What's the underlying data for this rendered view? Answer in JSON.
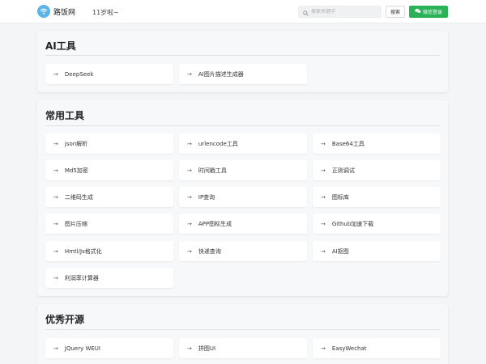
{
  "header": {
    "logo_text": "路饭网",
    "slogan": "11岁啦~",
    "search_placeholder": "搜索关键字",
    "search_button": "搜索",
    "wechat_login": "微信登录",
    "brand_color": "#2bb259",
    "logo_color": "#5ab4e8"
  },
  "sections": [
    {
      "title": "AI工具",
      "items": [
        "DeepSeek",
        "AI图片描述生成器"
      ]
    },
    {
      "title": "常用工具",
      "items": [
        "json解析",
        "urlencode工具",
        "Base64工具",
        "Md5加密",
        "时间戳工具",
        "正则调试",
        "二维码生成",
        "IP查询",
        "图标库",
        "图片压缩",
        "APP图标生成",
        "Github加速下载",
        "Hmtl/Js格式化",
        "快递查询",
        "AI抠图",
        "利润率计算器"
      ]
    },
    {
      "title": "优秀开源",
      "items": [
        "JQuery WEUI",
        "拼图UI",
        "EasyWechat"
      ]
    }
  ],
  "icons": {
    "arrow": "→",
    "search": "search-icon",
    "wechat": "wechat-icon",
    "logo": "wifi-icon"
  }
}
